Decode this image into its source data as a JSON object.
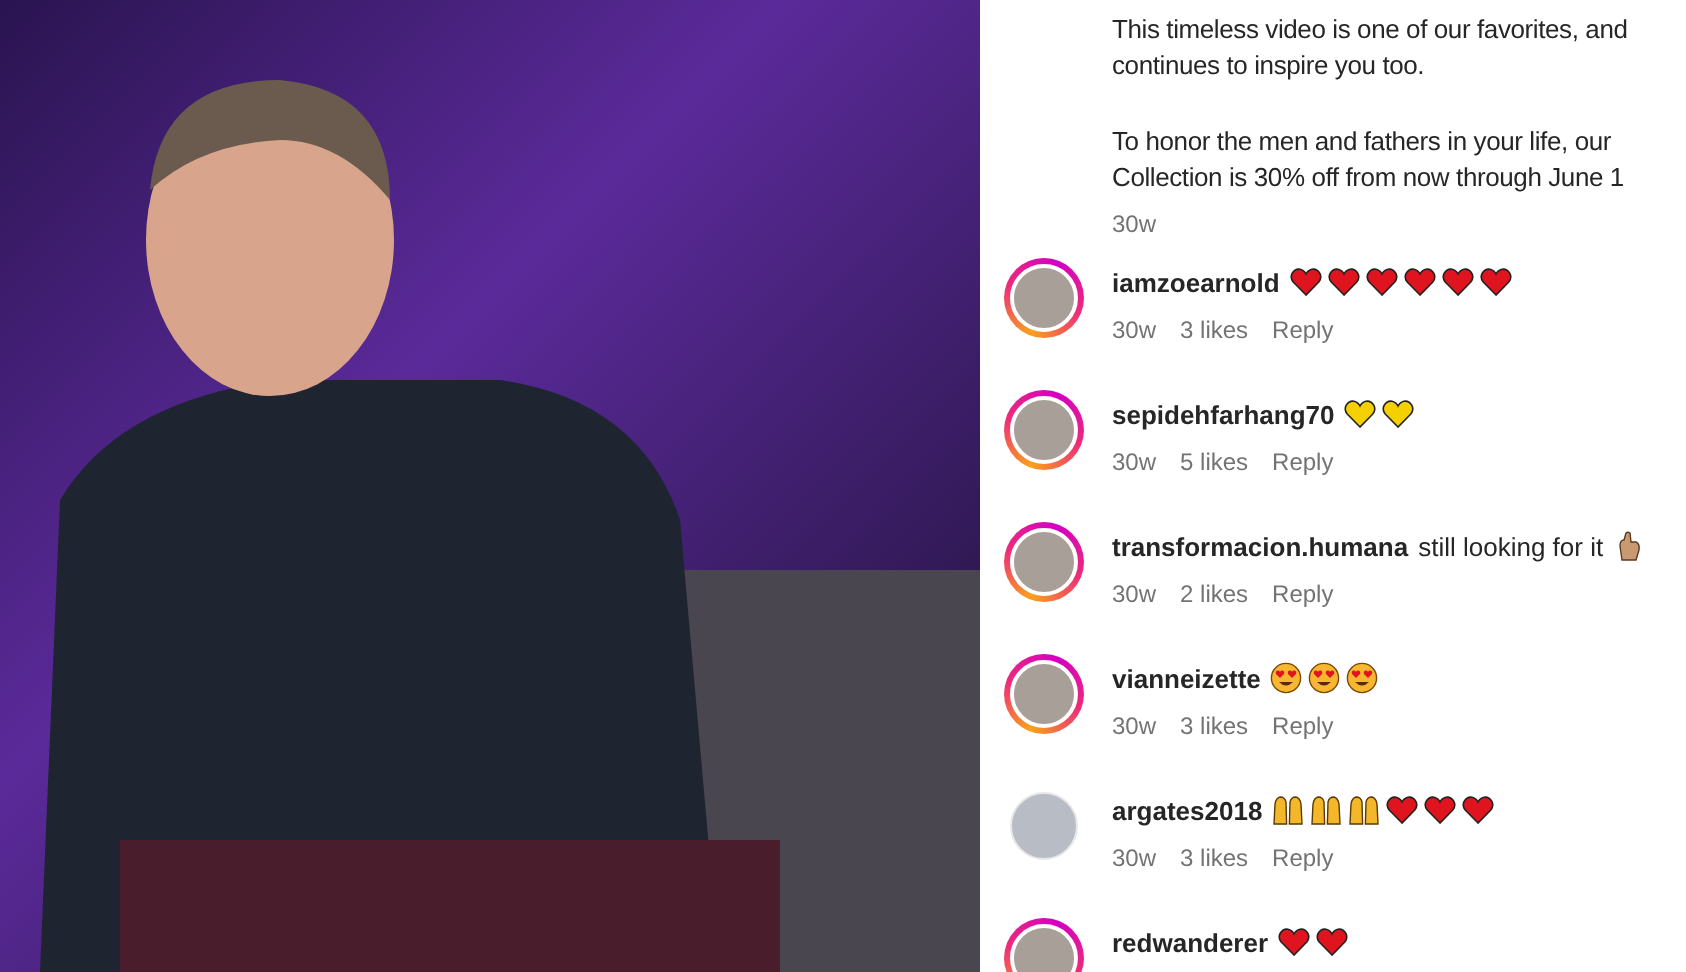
{
  "caption": {
    "lines": [
      "This timeless video is one of our favorites, and",
      "continues to inspire you too.",
      "To honor the men and fathers in your life, our",
      "Collection is 30% off from now through June 1"
    ],
    "time": "30w"
  },
  "comments": [
    {
      "user": "iamzoearnold",
      "emojis": [
        {
          "kind": "heart",
          "color": "#e0141e"
        },
        {
          "kind": "heart",
          "color": "#e0141e"
        },
        {
          "kind": "heart",
          "color": "#e0141e"
        },
        {
          "kind": "heart",
          "color": "#e0141e"
        },
        {
          "kind": "heart",
          "color": "#e0141e"
        },
        {
          "kind": "heart",
          "color": "#e0141e"
        }
      ],
      "story_ring": true,
      "time": "30w",
      "likes": "3 likes",
      "reply": "Reply"
    },
    {
      "user": "sepidehfarhang70",
      "emojis": [
        {
          "kind": "heart",
          "color": "#f5d000"
        },
        {
          "kind": "heart",
          "color": "#f5d000"
        }
      ],
      "story_ring": true,
      "time": "30w",
      "likes": "5 likes",
      "reply": "Reply"
    },
    {
      "user": "transformacion.humana",
      "text": "still looking for it",
      "emojis": [
        {
          "kind": "hand"
        }
      ],
      "story_ring": true,
      "time": "30w",
      "likes": "2 likes",
      "reply": "Reply"
    },
    {
      "user": "vianneizette",
      "emojis": [
        {
          "kind": "heart_eyes"
        },
        {
          "kind": "heart_eyes"
        },
        {
          "kind": "heart_eyes"
        }
      ],
      "story_ring": true,
      "time": "30w",
      "likes": "3 likes",
      "reply": "Reply"
    },
    {
      "user": "argates2018",
      "emojis": [
        {
          "kind": "raised_hands"
        },
        {
          "kind": "raised_hands"
        },
        {
          "kind": "raised_hands"
        },
        {
          "kind": "heart",
          "color": "#e0141e"
        },
        {
          "kind": "heart",
          "color": "#e0141e"
        },
        {
          "kind": "heart",
          "color": "#e0141e"
        }
      ],
      "story_ring": false,
      "time": "30w",
      "likes": "3 likes",
      "reply": "Reply"
    },
    {
      "user": "redwanderer",
      "emojis": [
        {
          "kind": "heart",
          "color": "#e0141e"
        },
        {
          "kind": "heart",
          "color": "#e0141e"
        }
      ],
      "story_ring": true
    }
  ]
}
